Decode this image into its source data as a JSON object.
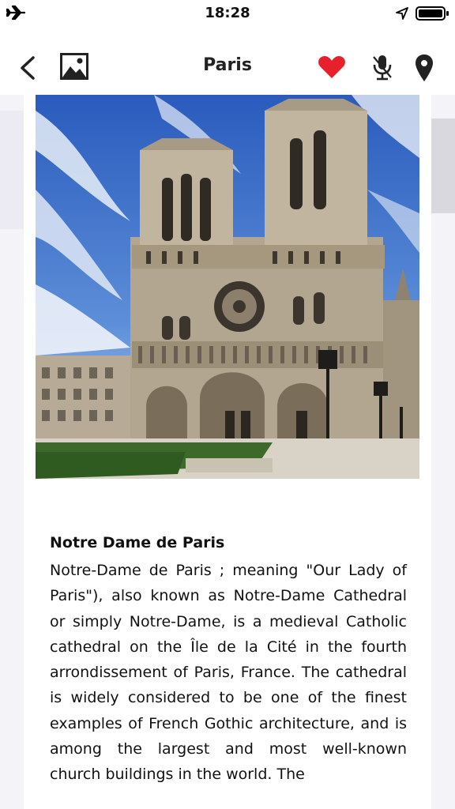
{
  "status_bar": {
    "time": "18:28",
    "icons": [
      "airplane-icon",
      "location-arrow-icon",
      "battery-icon"
    ]
  },
  "nav": {
    "title": "Paris",
    "icons": [
      "back-chevron-icon",
      "image-gallery-icon",
      "heart-icon",
      "microphone-icon",
      "map-pin-icon"
    ],
    "accent_color": "#e8202b"
  },
  "article": {
    "image_alt": "Notre Dame de Paris",
    "title": "Notre Dame de Paris",
    "body": "Notre-Dame de Paris ; meaning \"Our Lady of Paris\"), also known as Notre-Dame Cathedral or simply Notre-Dame, is a medieval Catholic cathedral on the Île de la Cité in the fourth arrondissement of Paris, France. The cathedral is widely considered to be one of the finest examples of French Gothic architecture, and is among the largest and most well-known church buildings in the world. The"
  }
}
